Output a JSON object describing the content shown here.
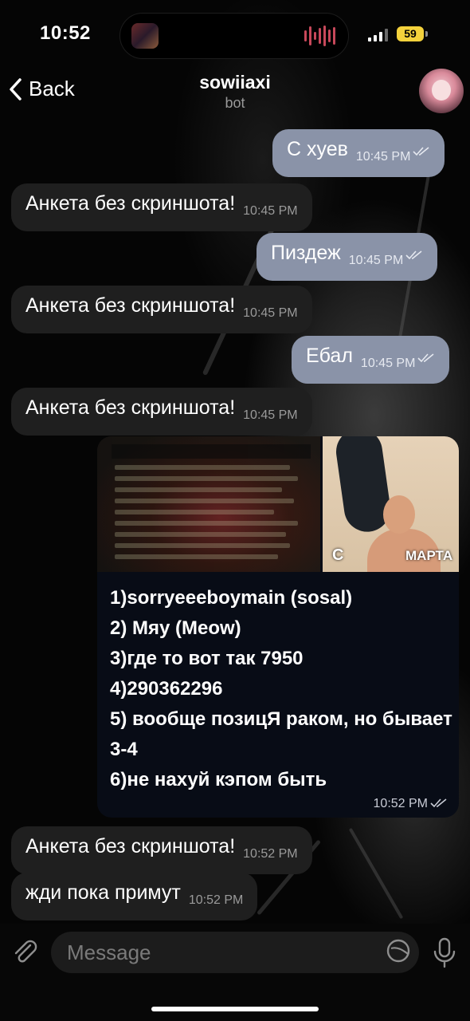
{
  "status_bar": {
    "time": "10:52",
    "battery": "59"
  },
  "header": {
    "back_label": "Back",
    "title": "sowiiaxi",
    "subtitle": "bot"
  },
  "messages": [
    {
      "text": "С хуев",
      "time": "10:45 PM"
    },
    {
      "text": "Анкета без скриншота!",
      "time": "10:45 PM"
    },
    {
      "text": "Пиздеж",
      "time": "10:45 PM"
    },
    {
      "text": "Анкета без скриншота!",
      "time": "10:45 PM"
    },
    {
      "text": "Ебал",
      "time": "10:45 PM"
    },
    {
      "text": "Анкета без скриншота!",
      "time": "10:45 PM"
    },
    {
      "image_caption_left": "С",
      "image_caption_right": "МАРТА",
      "lines": [
        "1)sorryeeeboymain (sosal)",
        "2) Мяу (Meow)",
        "3)где то вот так 7950",
        "4)290362296",
        "5) вообще позицЯ раком, но бывает 3-4",
        "6)не нахуй кэпом быть"
      ],
      "time": "10:52 PM"
    },
    {
      "text": "Анкета без скриншота!",
      "time": "10:52 PM"
    },
    {
      "text": "жди пока примут",
      "time": "10:52 PM"
    }
  ],
  "input": {
    "placeholder": "Message"
  },
  "colors": {
    "incoming_bubble": "#1f1f1f",
    "outgoing_bubble": "#8a93a8",
    "battery": "#f4d23c"
  }
}
